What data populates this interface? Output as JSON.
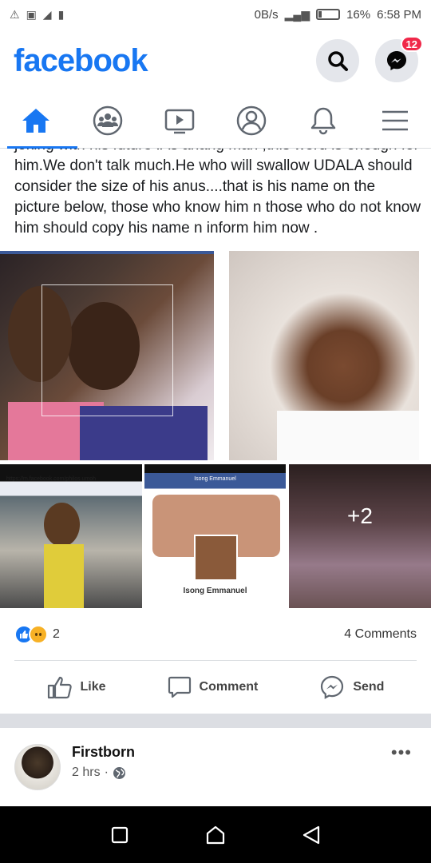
{
  "status_bar": {
    "network_speed": "0B/s",
    "battery": "16%",
    "time": "6:58 PM"
  },
  "header": {
    "logo": "facebook",
    "messenger_badge": "12"
  },
  "nav_tabs": [
    "home",
    "groups",
    "watch",
    "profile",
    "notifications",
    "menu"
  ],
  "post": {
    "text": "joking with his future .As anang man ,this word is enough for him.We don't talk much.He who will swallow UDALA should consider the size of his anus....that is his name on the picture below, those who know him n those who do not know him should copy his name n inform him now .",
    "photo3_url": "https://m.facebook.com/philos.umoh",
    "photo4_title": "Isong Emmanuel",
    "photo4_name": "Isong Emmanuel",
    "more_photos": "+2",
    "reaction_count": "2",
    "comments_count": "4 Comments"
  },
  "actions": {
    "like": "Like",
    "comment": "Comment",
    "send": "Send"
  },
  "next_post": {
    "author": "Firstborn",
    "time": "2 hrs",
    "separator": "·"
  },
  "colors": {
    "brand": "#1877f2",
    "badge": "#f02849"
  }
}
